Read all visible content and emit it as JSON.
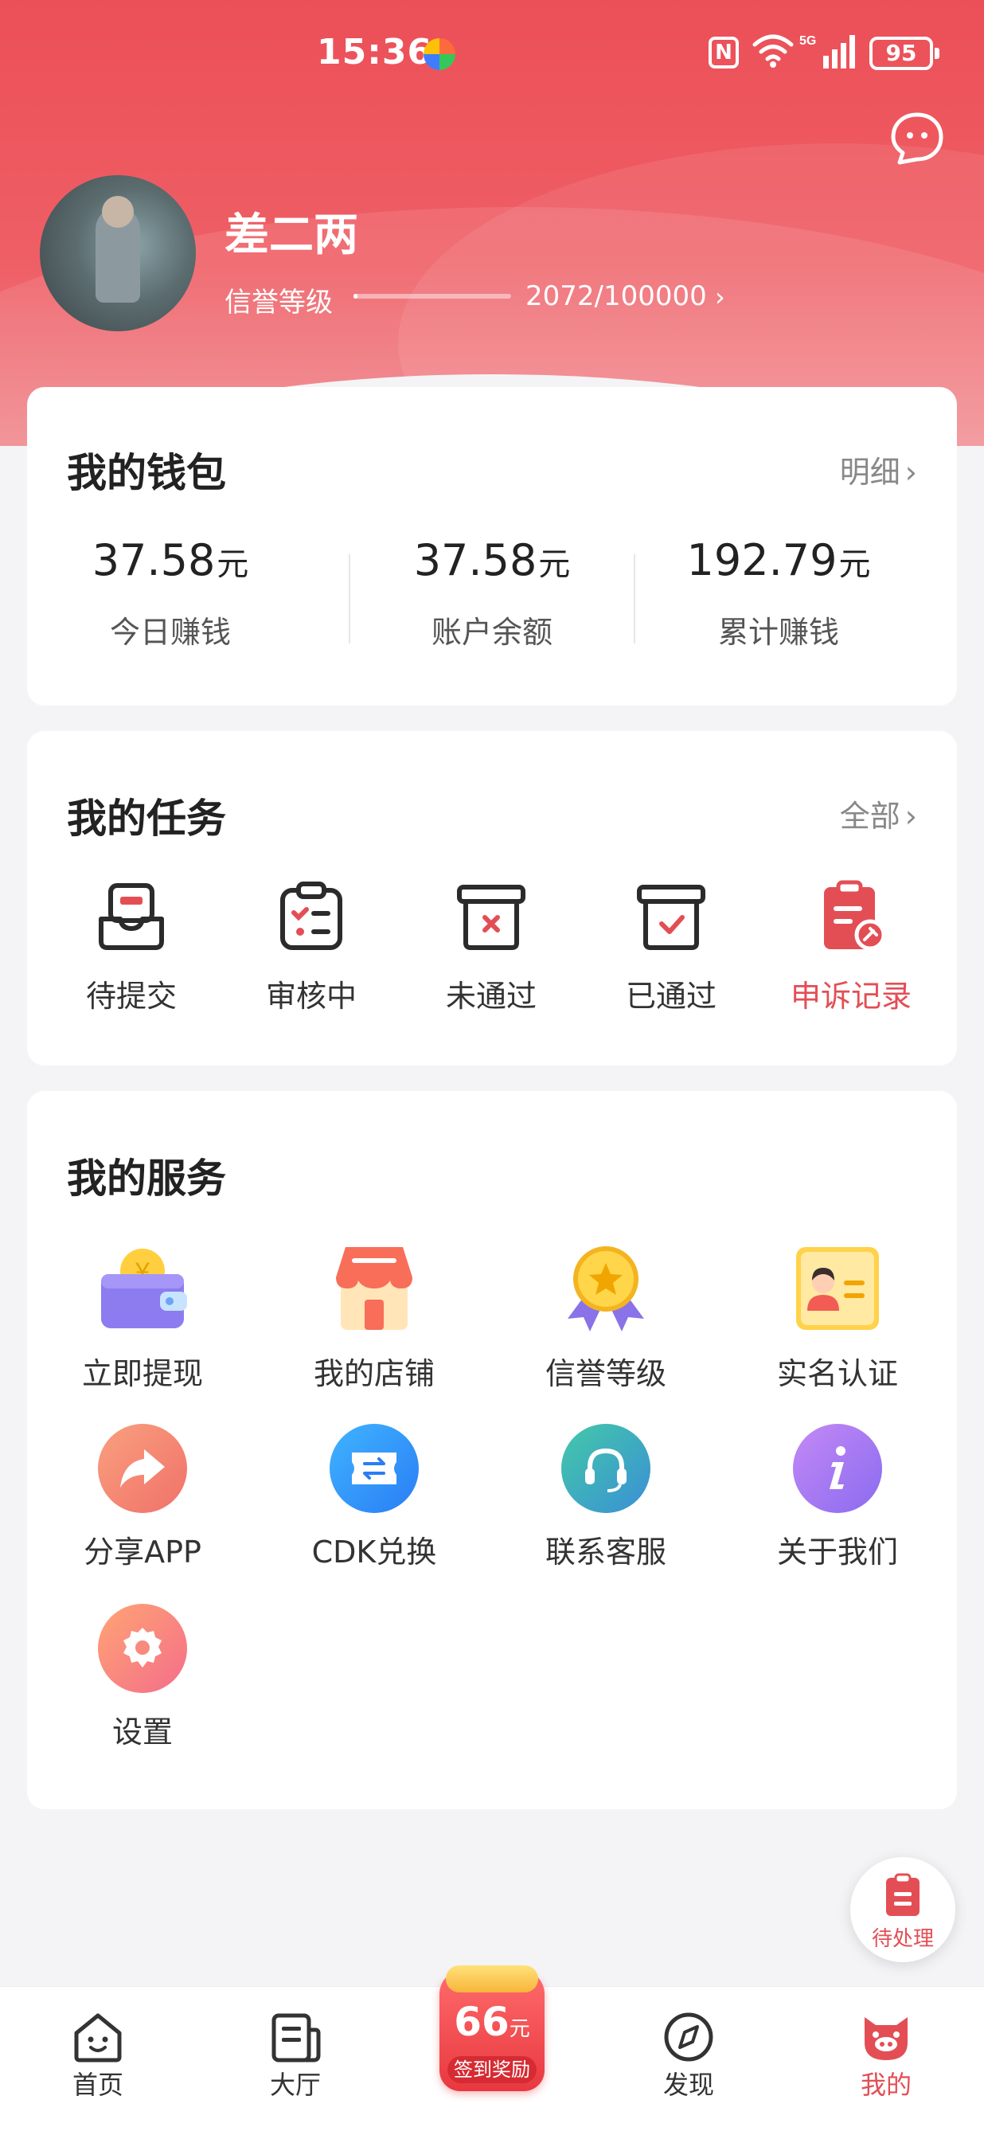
{
  "status_bar": {
    "time": "15:36",
    "network": "5G",
    "battery": "95",
    "nfc": "N"
  },
  "profile": {
    "username": "差二两",
    "credit_label": "信誉等级",
    "credit_value": "2072/100000",
    "credit_progress": 0.02072
  },
  "wallet": {
    "title": "我的钱包",
    "more": "明细",
    "items": [
      {
        "value": "37.58",
        "unit": "元",
        "label": "今日赚钱"
      },
      {
        "value": "37.58",
        "unit": "元",
        "label": "账户余额"
      },
      {
        "value": "192.79",
        "unit": "元",
        "label": "累计赚钱"
      }
    ]
  },
  "tasks": {
    "title": "我的任务",
    "more": "全部",
    "items": [
      {
        "label": "待提交",
        "icon": "inbox-icon"
      },
      {
        "label": "审核中",
        "icon": "clipboard-list-icon"
      },
      {
        "label": "未通过",
        "icon": "box-x-icon"
      },
      {
        "label": "已通过",
        "icon": "box-check-icon"
      },
      {
        "label": "申诉记录",
        "icon": "appeal-record-icon"
      }
    ]
  },
  "services": {
    "title": "我的服务",
    "items": [
      {
        "label": "立即提现",
        "icon": "wallet-icon"
      },
      {
        "label": "我的店铺",
        "icon": "store-icon"
      },
      {
        "label": "信誉等级",
        "icon": "medal-icon"
      },
      {
        "label": "实名认证",
        "icon": "id-card-icon"
      },
      {
        "label": "分享APP",
        "icon": "share-icon"
      },
      {
        "label": "CDK兑换",
        "icon": "exchange-icon"
      },
      {
        "label": "联系客服",
        "icon": "headset-icon"
      },
      {
        "label": "关于我们",
        "icon": "info-icon"
      },
      {
        "label": "设置",
        "icon": "gear-icon"
      }
    ]
  },
  "fab": {
    "label": "待处理"
  },
  "tabbar": {
    "items": [
      {
        "label": "首页",
        "icon": "home-face-icon"
      },
      {
        "label": "大厅",
        "icon": "hall-icon"
      },
      {
        "label": "发现",
        "icon": "compass-icon"
      },
      {
        "label": "我的",
        "icon": "piggy-icon"
      }
    ],
    "center": {
      "value": "66",
      "unit": "元",
      "label": "签到奖励"
    }
  },
  "colors": {
    "accent": "#e34e55",
    "header": "#ec4f57"
  }
}
